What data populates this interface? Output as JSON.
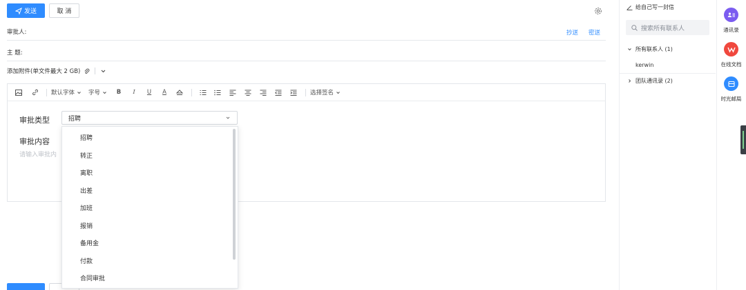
{
  "toolbar_top": {
    "send_label": "发送",
    "cancel_label": "取 消"
  },
  "fields": {
    "approver_label": "审批人:",
    "cc_label": "抄送",
    "bcc_label": "密送",
    "subject_label": "主 题:",
    "attachment_label": "添加附件(单文件最大 2 GB)"
  },
  "editor_toolbar": {
    "font_family": "默认字体",
    "font_size": "字号",
    "bold": "B",
    "italic": "I",
    "underline": "U",
    "font_color": "A",
    "signature": "选择签名"
  },
  "form": {
    "type_label": "审批类型",
    "type_value": "招聘",
    "content_label": "审批内容",
    "content_placeholder": "请输入审批内"
  },
  "dropdown": {
    "options": [
      "招聘",
      "转正",
      "离职",
      "出差",
      "加班",
      "报销",
      "备用金",
      "付款",
      "合同审批"
    ]
  },
  "contacts": {
    "write_to_self": "给自己写一封信",
    "search_placeholder": "搜索所有联系人",
    "all_contacts": "所有联系人 (1)",
    "contact_name": "kerwin",
    "team_contacts": "团队通讯录 (2)"
  },
  "apps": [
    {
      "label": "通讯录",
      "color": "#7b5cf0",
      "icon": "contacts-icon"
    },
    {
      "label": "在线文档",
      "color": "#f0483e",
      "icon": "docs-icon"
    },
    {
      "label": "时光邮局",
      "color": "#2f8cff",
      "icon": "time-mail-icon"
    }
  ],
  "colors": {
    "accent": "#2f8cff",
    "border": "#e3e6ea"
  }
}
